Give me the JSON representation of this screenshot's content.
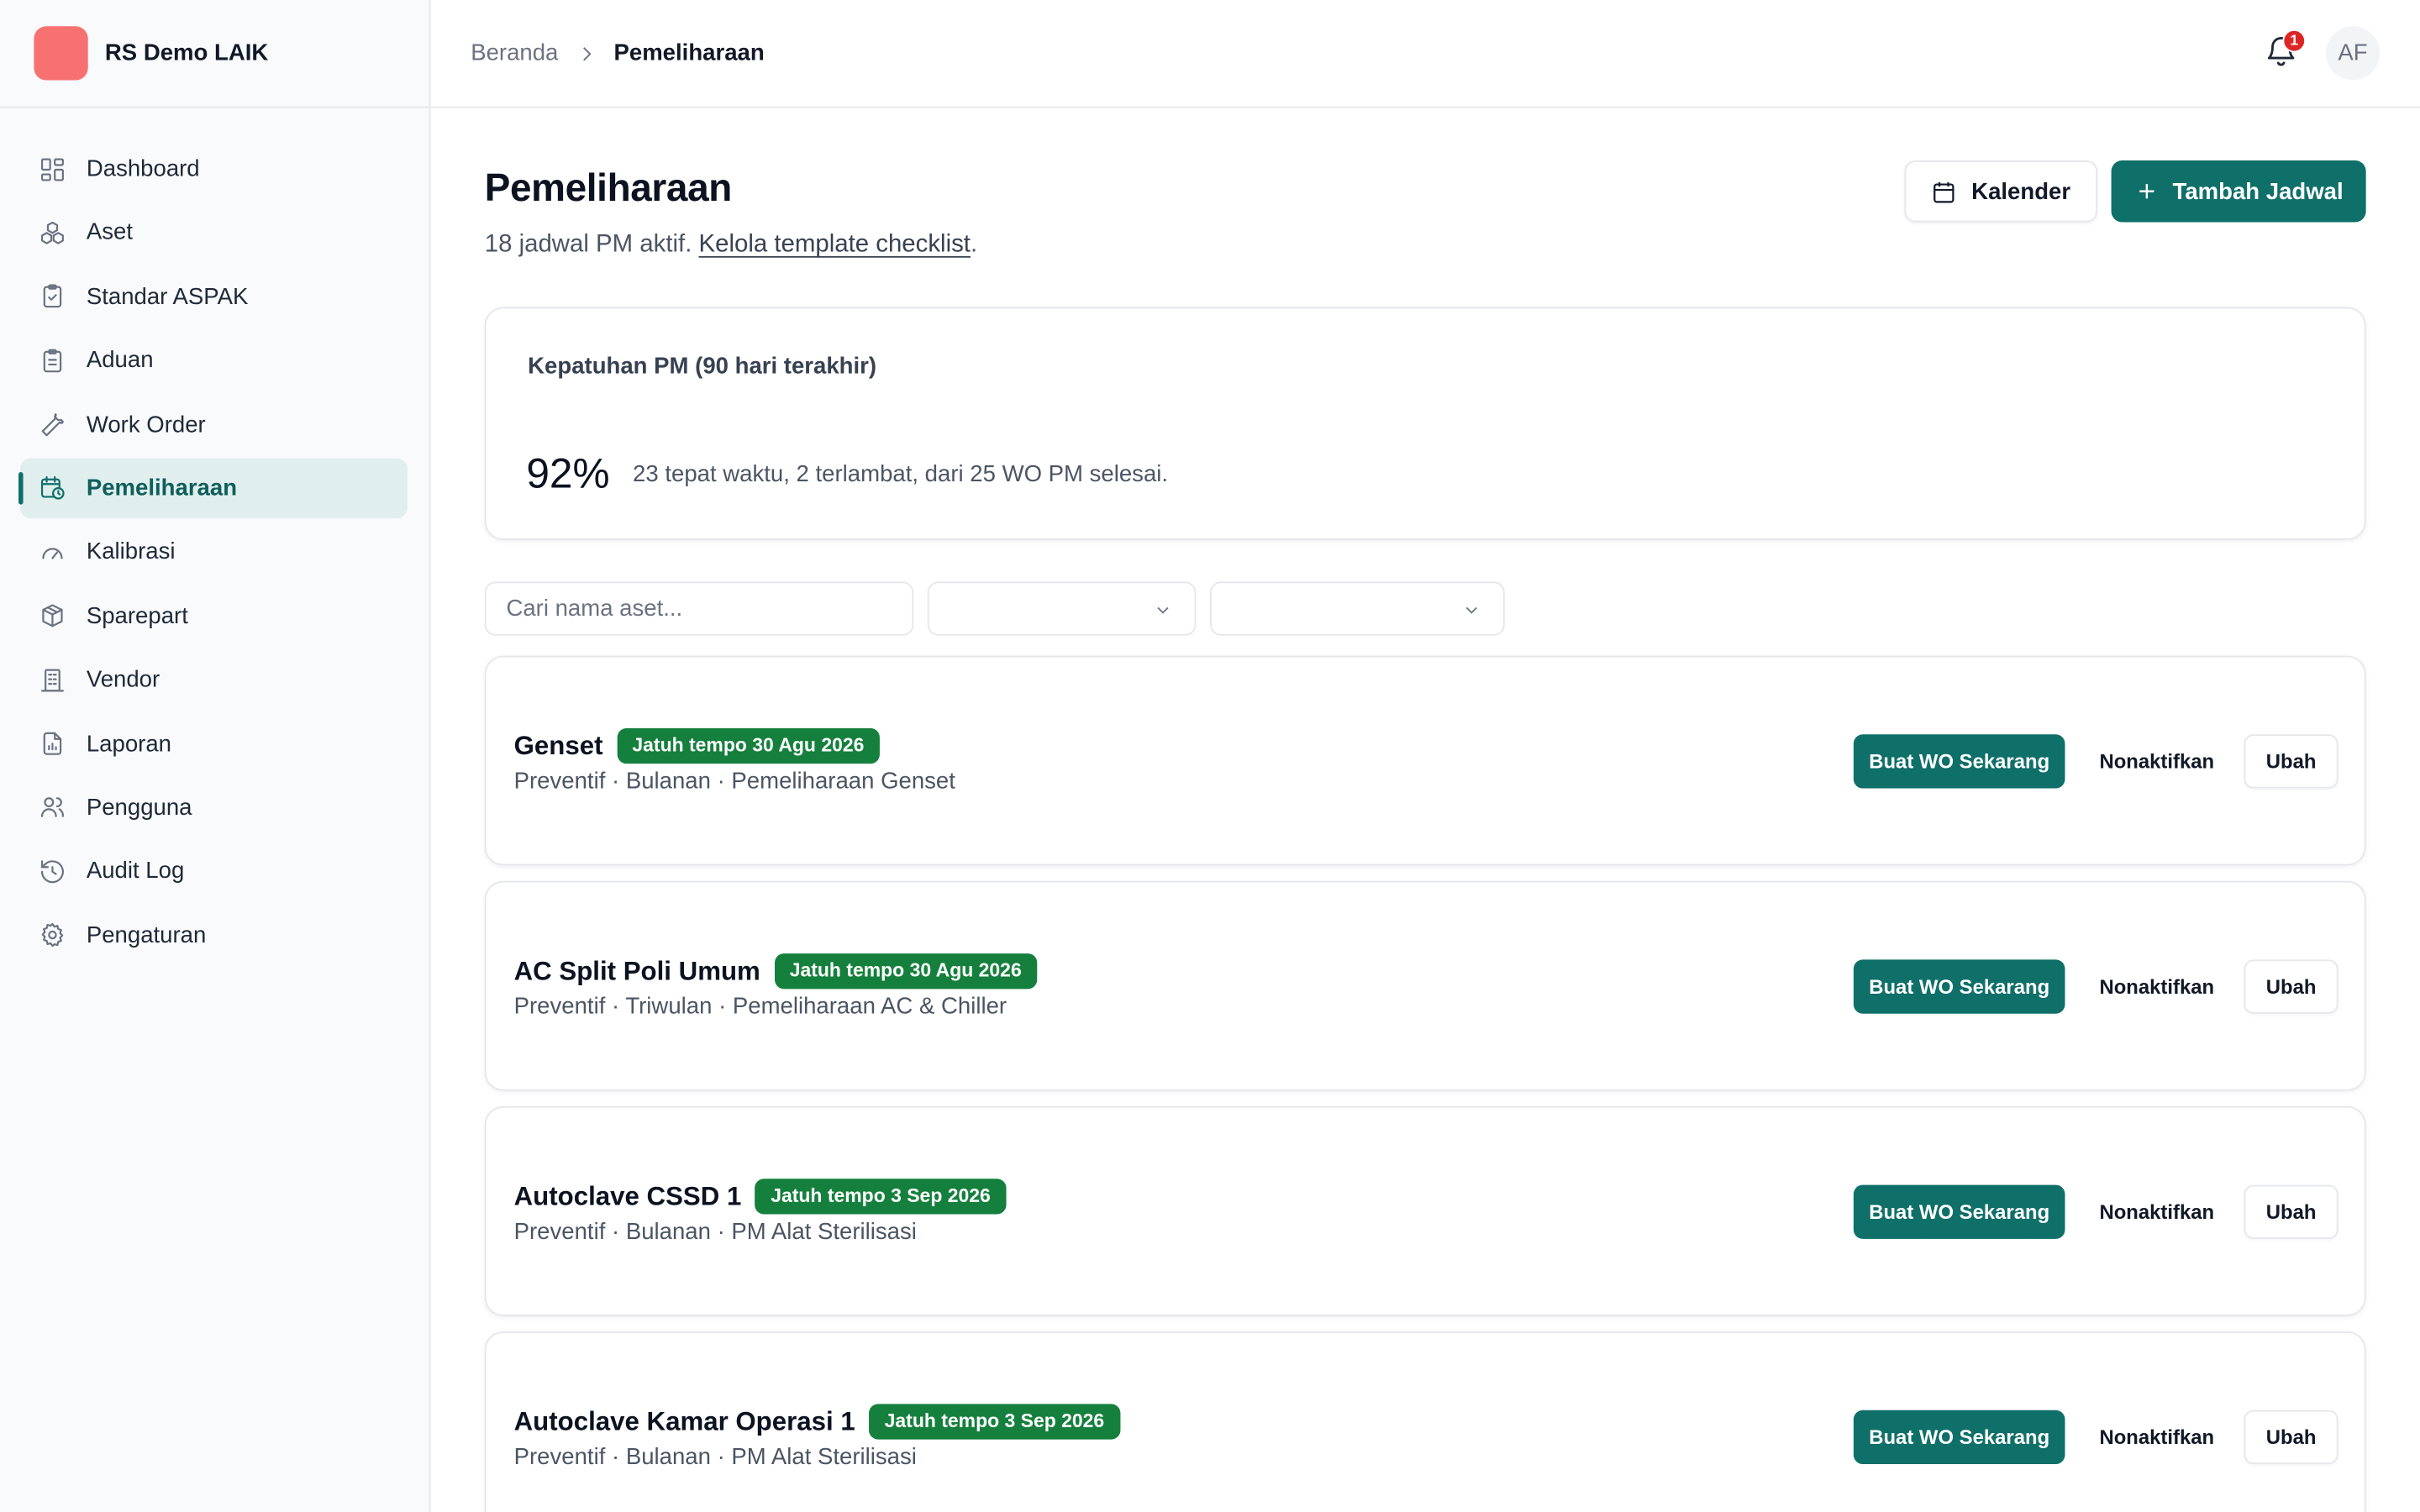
{
  "brand": {
    "name": "RS Demo LAIK",
    "logo_color": "#f87171"
  },
  "sidebar": {
    "items": [
      {
        "label": "Dashboard",
        "icon": "dashboard-icon"
      },
      {
        "label": "Aset",
        "icon": "assets-icon"
      },
      {
        "label": "Standar ASPAK",
        "icon": "clipboard-check-icon"
      },
      {
        "label": "Aduan",
        "icon": "clipboard-list-icon"
      },
      {
        "label": "Work Order",
        "icon": "wrench-icon"
      },
      {
        "label": "Pemeliharaan",
        "icon": "calendar-clock-icon",
        "active": true
      },
      {
        "label": "Kalibrasi",
        "icon": "gauge-icon"
      },
      {
        "label": "Sparepart",
        "icon": "package-icon"
      },
      {
        "label": "Vendor",
        "icon": "building-icon"
      },
      {
        "label": "Laporan",
        "icon": "file-chart-icon"
      },
      {
        "label": "Pengguna",
        "icon": "users-icon"
      },
      {
        "label": "Audit Log",
        "icon": "history-icon"
      },
      {
        "label": "Pengaturan",
        "icon": "gear-icon"
      }
    ]
  },
  "header": {
    "breadcrumb": [
      "Beranda",
      "Pemeliharaan"
    ],
    "notification_count": "1",
    "avatar_initials": "AF"
  },
  "page": {
    "title": "Pemeliharaan",
    "subtitle_prefix": "18 jadwal PM aktif. ",
    "subtitle_link": "Kelola template checklist",
    "subtitle_suffix": ".",
    "calendar_button": "Kalender",
    "add_button": "Tambah Jadwal"
  },
  "compliance": {
    "label": "Kepatuhan PM (90 hari terakhir)",
    "value": "92%",
    "note": "23 tepat waktu, 2 terlambat, dari 25 WO PM selesai."
  },
  "filters": {
    "search_placeholder": "Cari nama aset...",
    "select1_value": "",
    "select2_value": ""
  },
  "schedules": [
    {
      "name": "Genset",
      "badge": "Jatuh tempo 30 Agu 2026",
      "meta": "Preventif · Bulanan · Pemeliharaan Genset"
    },
    {
      "name": "AC Split Poli Umum",
      "badge": "Jatuh tempo 30 Agu 2026",
      "meta": "Preventif · Triwulan · Pemeliharaan AC & Chiller"
    },
    {
      "name": "Autoclave CSSD 1",
      "badge": "Jatuh tempo 3 Sep 2026",
      "meta": "Preventif · Bulanan · PM Alat Sterilisasi"
    },
    {
      "name": "Autoclave Kamar Operasi 1",
      "badge": "Jatuh tempo 3 Sep 2026",
      "meta": "Preventif · Bulanan · PM Alat Sterilisasi"
    }
  ],
  "actions": {
    "create_wo": "Buat WO Sekarang",
    "deactivate": "Nonaktifkan",
    "edit": "Ubah"
  },
  "colors": {
    "accent": "#0f6f69",
    "badge_green": "#15803d",
    "notification_red": "#dc2626",
    "active_nav_bg": "#e1eeee"
  }
}
